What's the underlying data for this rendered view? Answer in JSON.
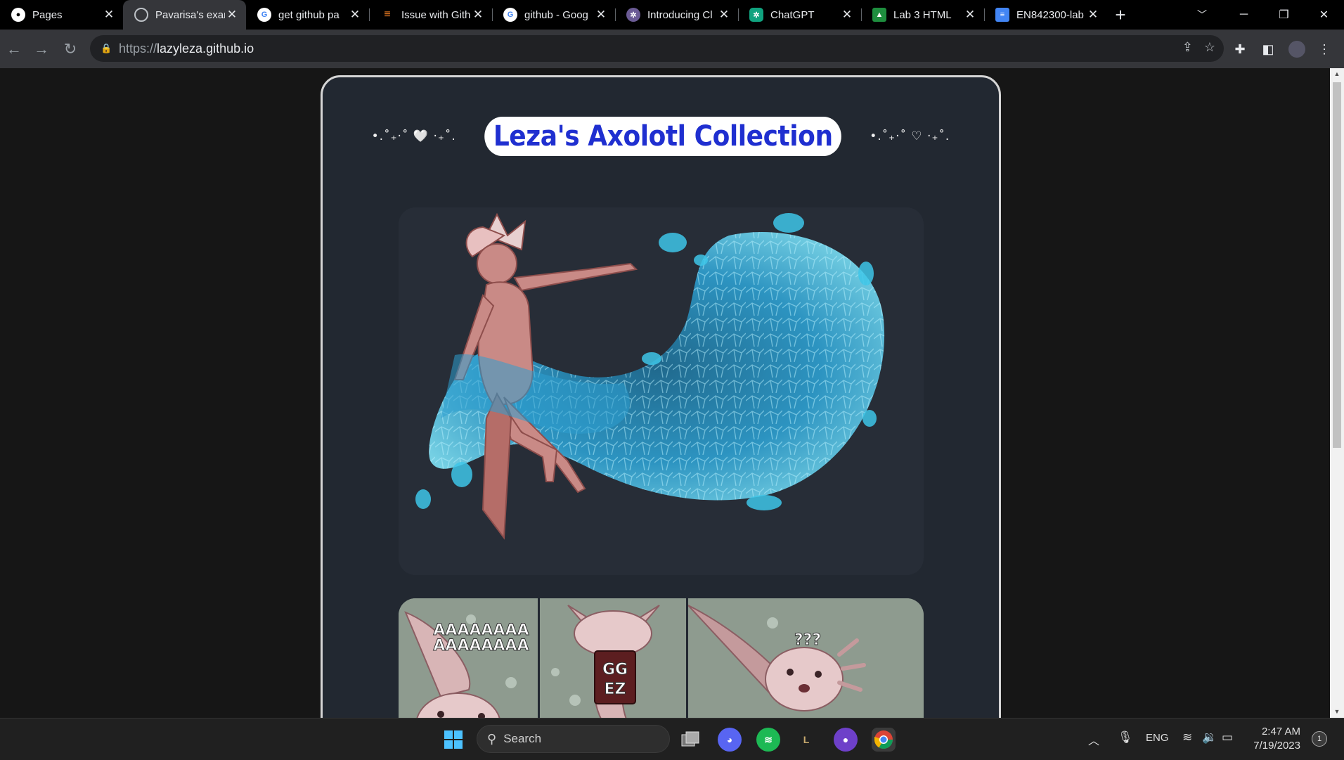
{
  "browser": {
    "tabs": [
      {
        "title": "Pages",
        "favicon": "github-icon",
        "active": false
      },
      {
        "title": "Pavarisa's exar",
        "favicon": "globe-icon",
        "active": true
      },
      {
        "title": "get github pa",
        "favicon": "google-icon",
        "active": false
      },
      {
        "title": "Issue with Gith",
        "favicon": "stackoverflow-icon",
        "active": false
      },
      {
        "title": "github - Goog",
        "favicon": "google-icon",
        "active": false
      },
      {
        "title": "Introducing Cl",
        "favicon": "openai-icon",
        "active": false
      },
      {
        "title": "ChatGPT",
        "favicon": "chatgpt-icon",
        "active": false
      },
      {
        "title": "Lab 3 HTML",
        "favicon": "classroom-icon",
        "active": false
      },
      {
        "title": "EN842300-lab",
        "favicon": "docs-icon",
        "active": false
      }
    ],
    "url_scheme": "https://",
    "url_host": "lazyleza.github.io"
  },
  "page": {
    "deco_left": "•.˚₊‧˚ 🤍 ‧₊˚.",
    "title": "Leza's Axolotl Collection",
    "deco_right": "•.˚₊‧˚ ♡ ‧₊˚.",
    "gallery": [
      {
        "caption": "AAAAAAAA AAAAAAAA"
      },
      {
        "caption": "GG EZ"
      },
      {
        "caption": "???"
      }
    ]
  },
  "taskbar": {
    "search_placeholder": "Search",
    "language": "ENG",
    "time": "2:47 AM",
    "date": "7/19/2023",
    "notification_count": "1"
  },
  "colors": {
    "title_blue": "#1f2fd0",
    "card_bg": "#222831",
    "water_cyan": "#3ec6e8",
    "axolotl_pink": "#c98a86"
  }
}
